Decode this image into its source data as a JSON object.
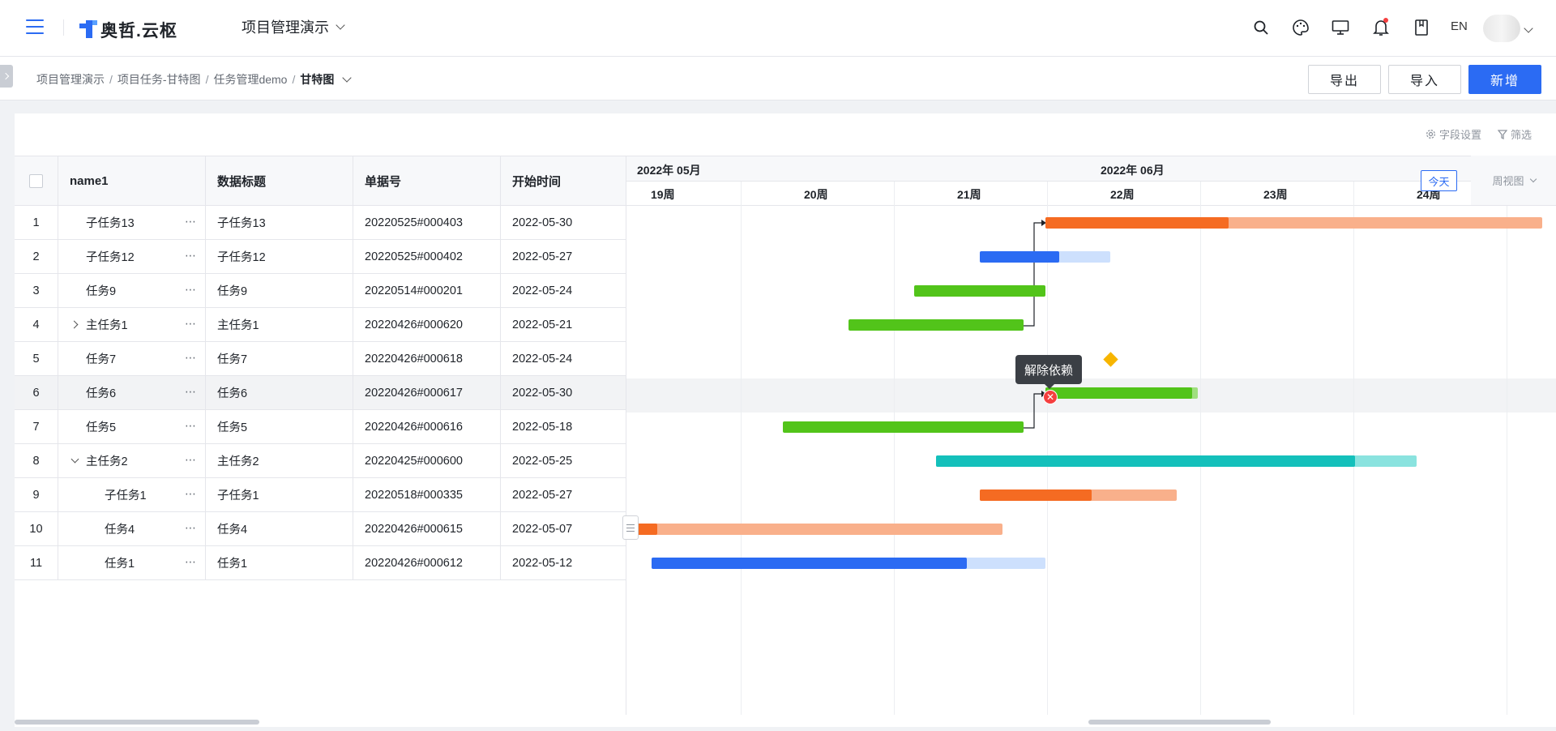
{
  "header": {
    "logo_text": "奥哲.云枢",
    "project": "项目管理演示",
    "lang": "EN"
  },
  "breadcrumb": {
    "items": [
      "项目管理演示",
      "项目任务-甘特图",
      "任务管理demo"
    ],
    "current": "甘特图"
  },
  "actions": {
    "export": "导出",
    "import": "导入",
    "add": "新增"
  },
  "toolbar": {
    "field_settings": "字段设置",
    "filter": "筛选"
  },
  "table": {
    "columns": [
      "name1",
      "数据标题",
      "单据号",
      "开始时间"
    ],
    "rows": [
      {
        "no": "1",
        "name": "子任务13",
        "title": "子任务13",
        "code": "20220525#000403",
        "start": "2022-05-30"
      },
      {
        "no": "2",
        "name": "子任务12",
        "title": "子任务12",
        "code": "20220525#000402",
        "start": "2022-05-27"
      },
      {
        "no": "3",
        "name": "任务9",
        "title": "任务9",
        "code": "20220514#000201",
        "start": "2022-05-24"
      },
      {
        "no": "4",
        "name": "主任务1",
        "title": "主任务1",
        "code": "20220426#000620",
        "start": "2022-05-21"
      },
      {
        "no": "5",
        "name": "任务7",
        "title": "任务7",
        "code": "20220426#000618",
        "start": "2022-05-24"
      },
      {
        "no": "6",
        "name": "任务6",
        "title": "任务6",
        "code": "20220426#000617",
        "start": "2022-05-30"
      },
      {
        "no": "7",
        "name": "任务5",
        "title": "任务5",
        "code": "20220426#000616",
        "start": "2022-05-18"
      },
      {
        "no": "8",
        "name": "主任务2",
        "title": "主任务2",
        "code": "20220425#000600",
        "start": "2022-05-25"
      },
      {
        "no": "9",
        "name": "子任务1",
        "title": "子任务1",
        "code": "20220518#000335",
        "start": "2022-05-27"
      },
      {
        "no": "10",
        "name": "任务4",
        "title": "任务4",
        "code": "20220426#000615",
        "start": "2022-05-07"
      },
      {
        "no": "11",
        "name": "任务1",
        "title": "任务1",
        "code": "20220426#000612",
        "start": "2022-05-12"
      }
    ]
  },
  "gantt": {
    "months": [
      "2022年 05月",
      "2022年 06月"
    ],
    "weeks": [
      "19周",
      "20周",
      "21周",
      "22周",
      "23周",
      "24周"
    ],
    "today": "今天",
    "view": "周视图",
    "tooltip": "解除依赖",
    "unlink_symbol": "✕",
    "colors": {
      "orange": "#f56b22",
      "orange_light": "#f9b08b",
      "blue": "#2b6bf3",
      "blue_light": "#cde0fd",
      "green": "#52c41a",
      "green_light": "#a0df7f",
      "teal": "#14c0bb",
      "teal_light": "#8ae3df",
      "milestone": "#f7b500"
    }
  }
}
